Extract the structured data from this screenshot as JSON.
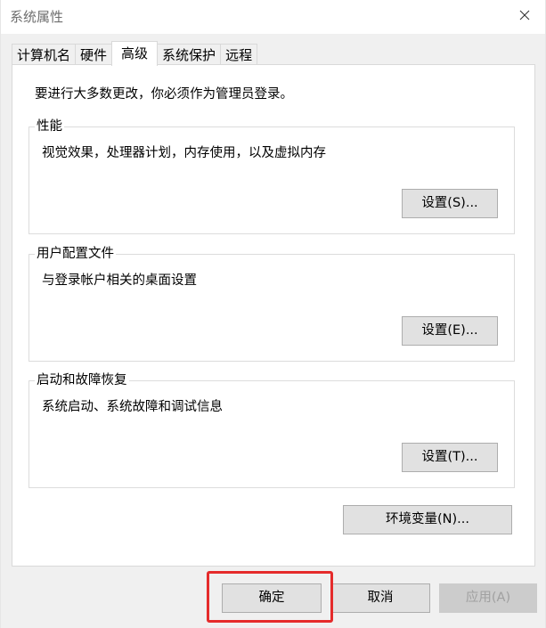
{
  "window": {
    "title": "系统属性",
    "close_icon": "close-icon"
  },
  "tabs": [
    {
      "label": "计算机名",
      "active": false
    },
    {
      "label": "硬件",
      "active": false
    },
    {
      "label": "高级",
      "active": true
    },
    {
      "label": "系统保护",
      "active": false
    },
    {
      "label": "远程",
      "active": false
    }
  ],
  "panel": {
    "admin_note": "要进行大多数更改，你必须作为管理员登录。",
    "performance": {
      "label": "性能",
      "desc": "视觉效果，处理器计划，内存使用，以及虚拟内存",
      "button": "设置(S)..."
    },
    "user_profiles": {
      "label": "用户配置文件",
      "desc": "与登录帐户相关的桌面设置",
      "button": "设置(E)..."
    },
    "startup_recovery": {
      "label": "启动和故障恢复",
      "desc": "系统启动、系统故障和调试信息",
      "button": "设置(T)..."
    },
    "env_vars_button": "环境变量(N)..."
  },
  "footer": {
    "ok": "确定",
    "cancel": "取消",
    "apply": "应用(A)",
    "apply_enabled": false
  },
  "colors": {
    "highlight": "#e52b2b",
    "button_face": "#e1e1e1",
    "window_bg": "#f0f0f0"
  }
}
